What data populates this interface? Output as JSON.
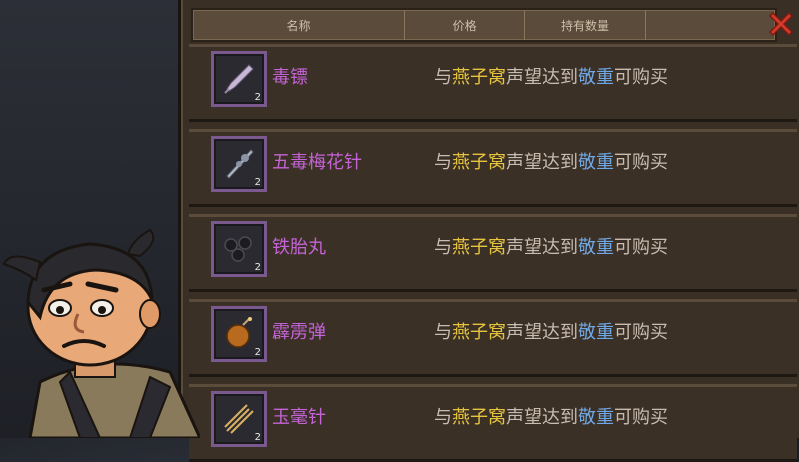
{
  "header": {
    "columns": [
      "名称",
      "价格",
      "持有数量"
    ]
  },
  "items": [
    {
      "name": "毒镖",
      "count": "2",
      "icon": "dart-icon"
    },
    {
      "name": "五毒梅花针",
      "count": "2",
      "icon": "plum-needle-icon"
    },
    {
      "name": "铁胎丸",
      "count": "2",
      "icon": "iron-balls-icon"
    },
    {
      "name": "霹雳弹",
      "count": "2",
      "icon": "thunder-bomb-icon"
    },
    {
      "name": "玉毫针",
      "count": "2",
      "icon": "jade-needles-icon"
    }
  ],
  "requirement": {
    "prefix": "与",
    "faction": "燕子窝",
    "middle": "声望达到",
    "level": "敬重",
    "suffix": "可购买"
  },
  "colors": {
    "item_name": "#c463d6",
    "faction": "#e7c43d",
    "level": "#6fa8e6",
    "close": "#d23a2a"
  }
}
